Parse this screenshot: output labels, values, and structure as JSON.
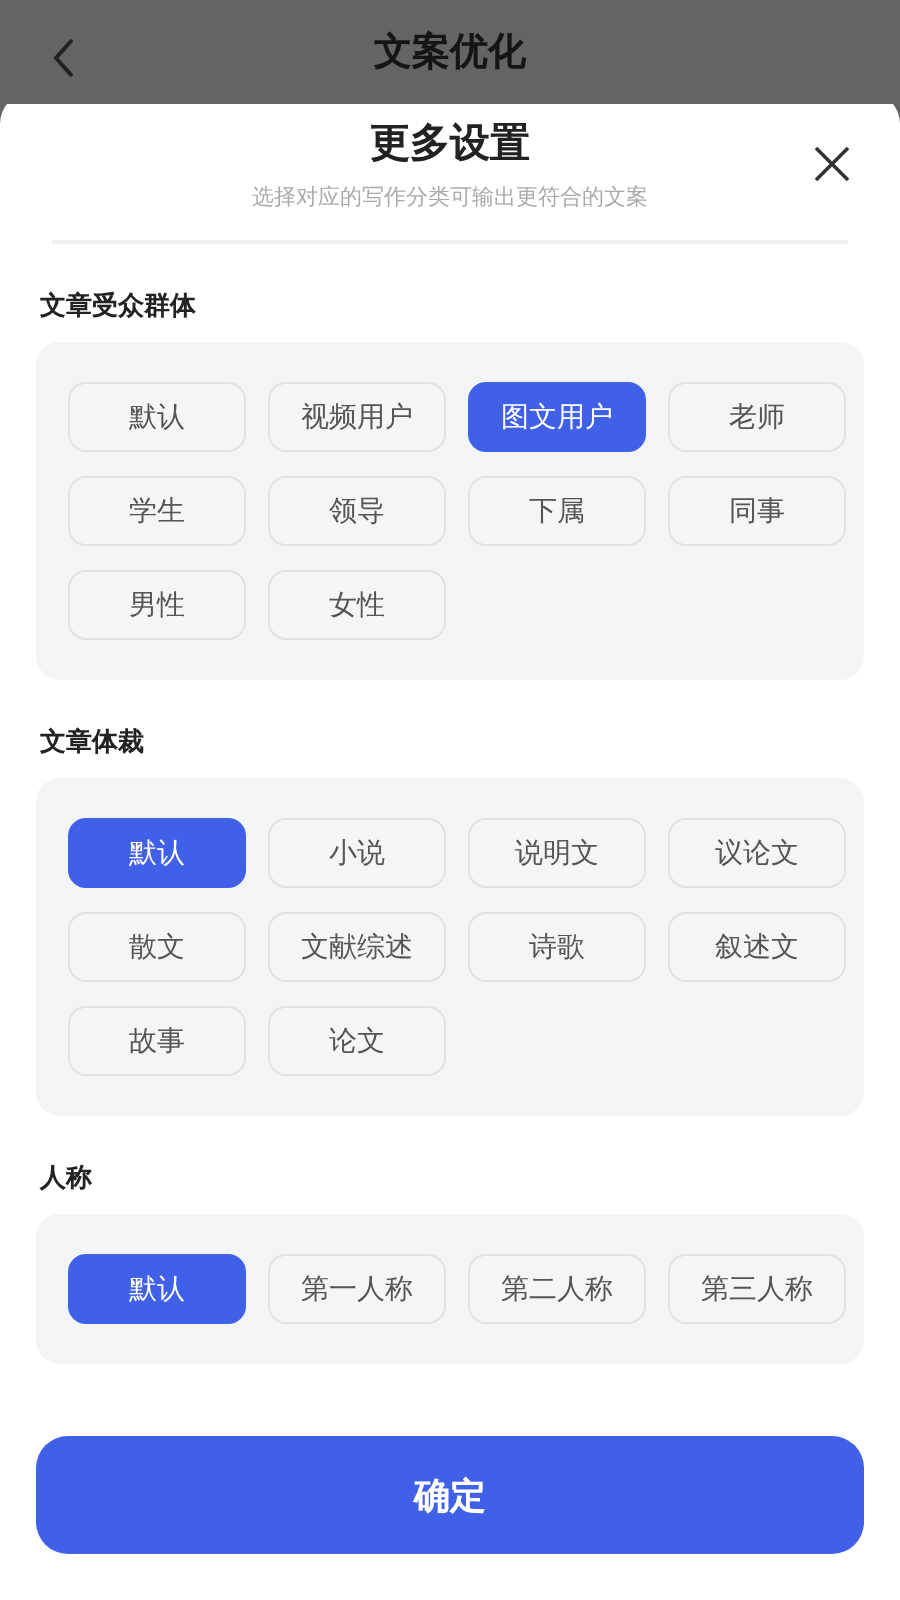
{
  "header": {
    "title": "文案优化"
  },
  "sheet": {
    "title": "更多设置",
    "subtitle": "选择对应的写作分类可输出更符合的文案"
  },
  "sections": [
    {
      "label": "文章受众群体",
      "options": [
        {
          "label": "默认",
          "selected": false
        },
        {
          "label": "视频用户",
          "selected": false
        },
        {
          "label": "图文用户",
          "selected": true
        },
        {
          "label": "老师",
          "selected": false
        },
        {
          "label": "学生",
          "selected": false
        },
        {
          "label": "领导",
          "selected": false
        },
        {
          "label": "下属",
          "selected": false
        },
        {
          "label": "同事",
          "selected": false
        },
        {
          "label": "男性",
          "selected": false
        },
        {
          "label": "女性",
          "selected": false
        }
      ]
    },
    {
      "label": "文章体裁",
      "options": [
        {
          "label": "默认",
          "selected": true
        },
        {
          "label": "小说",
          "selected": false
        },
        {
          "label": "说明文",
          "selected": false
        },
        {
          "label": "议论文",
          "selected": false
        },
        {
          "label": "散文",
          "selected": false
        },
        {
          "label": "文献综述",
          "selected": false
        },
        {
          "label": "诗歌",
          "selected": false
        },
        {
          "label": "叙述文",
          "selected": false
        },
        {
          "label": "故事",
          "selected": false
        },
        {
          "label": "论文",
          "selected": false
        }
      ]
    },
    {
      "label": "人称",
      "options": [
        {
          "label": "默认",
          "selected": true
        },
        {
          "label": "第一人称",
          "selected": false
        },
        {
          "label": "第二人称",
          "selected": false
        },
        {
          "label": "第三人称",
          "selected": false
        }
      ]
    }
  ],
  "confirm_button": "确定"
}
